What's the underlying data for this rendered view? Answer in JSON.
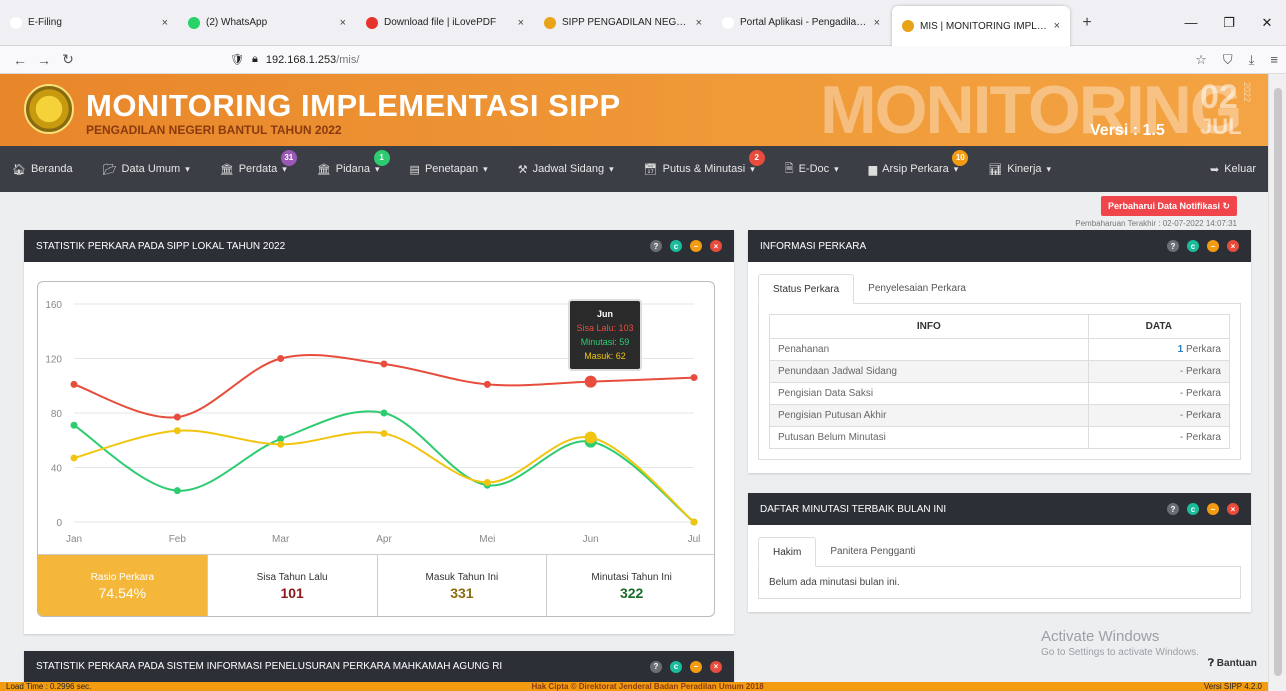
{
  "browser": {
    "tabs": [
      {
        "title": "E-Filing",
        "fav_color": "#ffffff",
        "active": false
      },
      {
        "title": "(2) WhatsApp",
        "fav_color": "#25d366",
        "active": false
      },
      {
        "title": "Download file | iLovePDF",
        "fav_color": "#e5322d",
        "active": false
      },
      {
        "title": "SIPP PENGADILAN NEGERI BAN",
        "fav_color": "#e8a317",
        "active": false
      },
      {
        "title": "Portal Aplikasi - Pengadilan Negeri",
        "fav_color": "#ffffff",
        "active": false
      },
      {
        "title": "MIS | MONITORING IMPLEMEN",
        "fav_color": "#e8a317",
        "active": true
      }
    ],
    "url_host": "192.168.1.253",
    "url_path": "/mis/"
  },
  "header": {
    "title": "MONITORING IMPLEMENTASI SIPP",
    "subtitle": "PENGADILAN NEGERI BANTUL TAHUN 2022",
    "big_word": "MONITORING",
    "version": "Versi : 1.5",
    "day": "02",
    "year": "2022",
    "month": "JUL"
  },
  "menu": [
    {
      "label": "Beranda",
      "icon": "home-icon",
      "glyph": "🏠︎",
      "caret": false,
      "badge": null
    },
    {
      "label": "Data Umum",
      "icon": "folder-icon",
      "glyph": "📂︎",
      "caret": true,
      "badge": null
    },
    {
      "label": "Perdata",
      "icon": "institution-icon",
      "glyph": "🏛︎",
      "caret": true,
      "badge": "31",
      "badge_color": "#9b59b6"
    },
    {
      "label": "Pidana",
      "icon": "institution-icon",
      "glyph": "🏛︎",
      "caret": true,
      "badge": "1",
      "badge_color": "#2ecc71"
    },
    {
      "label": "Penetapan",
      "icon": "list-icon",
      "glyph": "▤",
      "caret": true,
      "badge": null
    },
    {
      "label": "Jadwal Sidang",
      "icon": "gavel-icon",
      "glyph": "⚒︎",
      "caret": true,
      "badge": null
    },
    {
      "label": "Putus & Minutasi",
      "icon": "calendar-icon",
      "glyph": "📅︎",
      "caret": true,
      "badge": "2",
      "badge_color": "#e74c3c"
    },
    {
      "label": "E-Doc",
      "icon": "document-icon",
      "glyph": "🗎",
      "caret": true,
      "badge": null
    },
    {
      "label": "Arsip Perkara",
      "icon": "archive-icon",
      "glyph": "▆",
      "caret": true,
      "badge": "10",
      "badge_color": "#f39c12"
    },
    {
      "label": "Kinerja",
      "icon": "bar-chart-icon",
      "glyph": "📊︎",
      "caret": true,
      "badge": null
    },
    {
      "label": "Keluar",
      "icon": "logout-icon",
      "glyph": "➥",
      "caret": false,
      "badge": null
    }
  ],
  "refresh_button": "Perbaharui Data Notifikasi",
  "last_update": "Pembaharuan Terakhir : 02-07-2022 14:07:31",
  "stat_panel": {
    "title": "STATISTIK PERKARA PADA SIPP LOKAL TAHUN 2022",
    "tooltip": {
      "month": "Jun",
      "sisa": "Sisa Lalu: 103",
      "minutasi": "Minutasi: 59",
      "masuk": "Masuk: 62"
    },
    "stats": [
      {
        "label": "Rasio Perkara",
        "value": "74.54%",
        "color": "#ffffff"
      },
      {
        "label": "Sisa Tahun Lalu",
        "value": "101",
        "color": "#8b1a1a"
      },
      {
        "label": "Masuk Tahun Ini",
        "value": "331",
        "color": "#8a6d10"
      },
      {
        "label": "Minutasi Tahun Ini",
        "value": "322",
        "color": "#1a6b2a"
      }
    ]
  },
  "chart_data": {
    "type": "line",
    "categories": [
      "Jan",
      "Feb",
      "Mar",
      "Apr",
      "Mei",
      "Jun",
      "Jul"
    ],
    "ylim": [
      0,
      160
    ],
    "yticks": [
      0,
      40,
      80,
      120,
      160
    ],
    "grid": true,
    "series": [
      {
        "name": "Sisa Lalu",
        "color": "#e74c3c",
        "values": [
          101,
          77,
          120,
          116,
          101,
          103,
          106
        ]
      },
      {
        "name": "Minutasi",
        "color": "#2ecc71",
        "values": [
          71,
          23,
          61,
          80,
          27,
          59,
          0
        ]
      },
      {
        "name": "Masuk",
        "color": "#f1c40f",
        "values": [
          47,
          67,
          57,
          65,
          29,
          62,
          0
        ]
      }
    ]
  },
  "info_panel": {
    "title": "INFORMASI PERKARA",
    "tabs": [
      "Status Perkara",
      "Penyelesaian Perkara"
    ],
    "headers": [
      "INFO",
      "DATA"
    ],
    "rows": [
      {
        "info": "Penahanan",
        "num": "1",
        "unit": " Perkara"
      },
      {
        "info": "Penundaan Jadwal Sidang",
        "num": "-",
        "unit": " Perkara"
      },
      {
        "info": "Pengisian Data Saksi",
        "num": "-",
        "unit": " Perkara"
      },
      {
        "info": "Pengisian Putusan Akhir",
        "num": "-",
        "unit": " Perkara"
      },
      {
        "info": "Putusan Belum Minutasi",
        "num": "-",
        "unit": " Perkara"
      }
    ]
  },
  "minutasi_panel": {
    "title": "DAFTAR MINUTASI TERBAIK BULAN INI",
    "tabs": [
      "Hakim",
      "Panitera Pengganti"
    ],
    "empty": "Belum ada minutasi bulan ini."
  },
  "stat_panel2": {
    "title": "STATISTIK PERKARA PADA SISTEM INFORMASI PENELUSURAN PERKARA MAHKAMAH AGUNG RI"
  },
  "watermark": {
    "line1": "Activate Windows",
    "line2": "Go to Settings to activate Windows."
  },
  "help": "Bantuan",
  "footer": {
    "load": "Load Time : 0.2996 sec.",
    "copyright": "Hak Cipta © Direktorat Jenderal Badan Peradilan Umum 2018",
    "version": "Versi SIPP 4.2.0"
  }
}
